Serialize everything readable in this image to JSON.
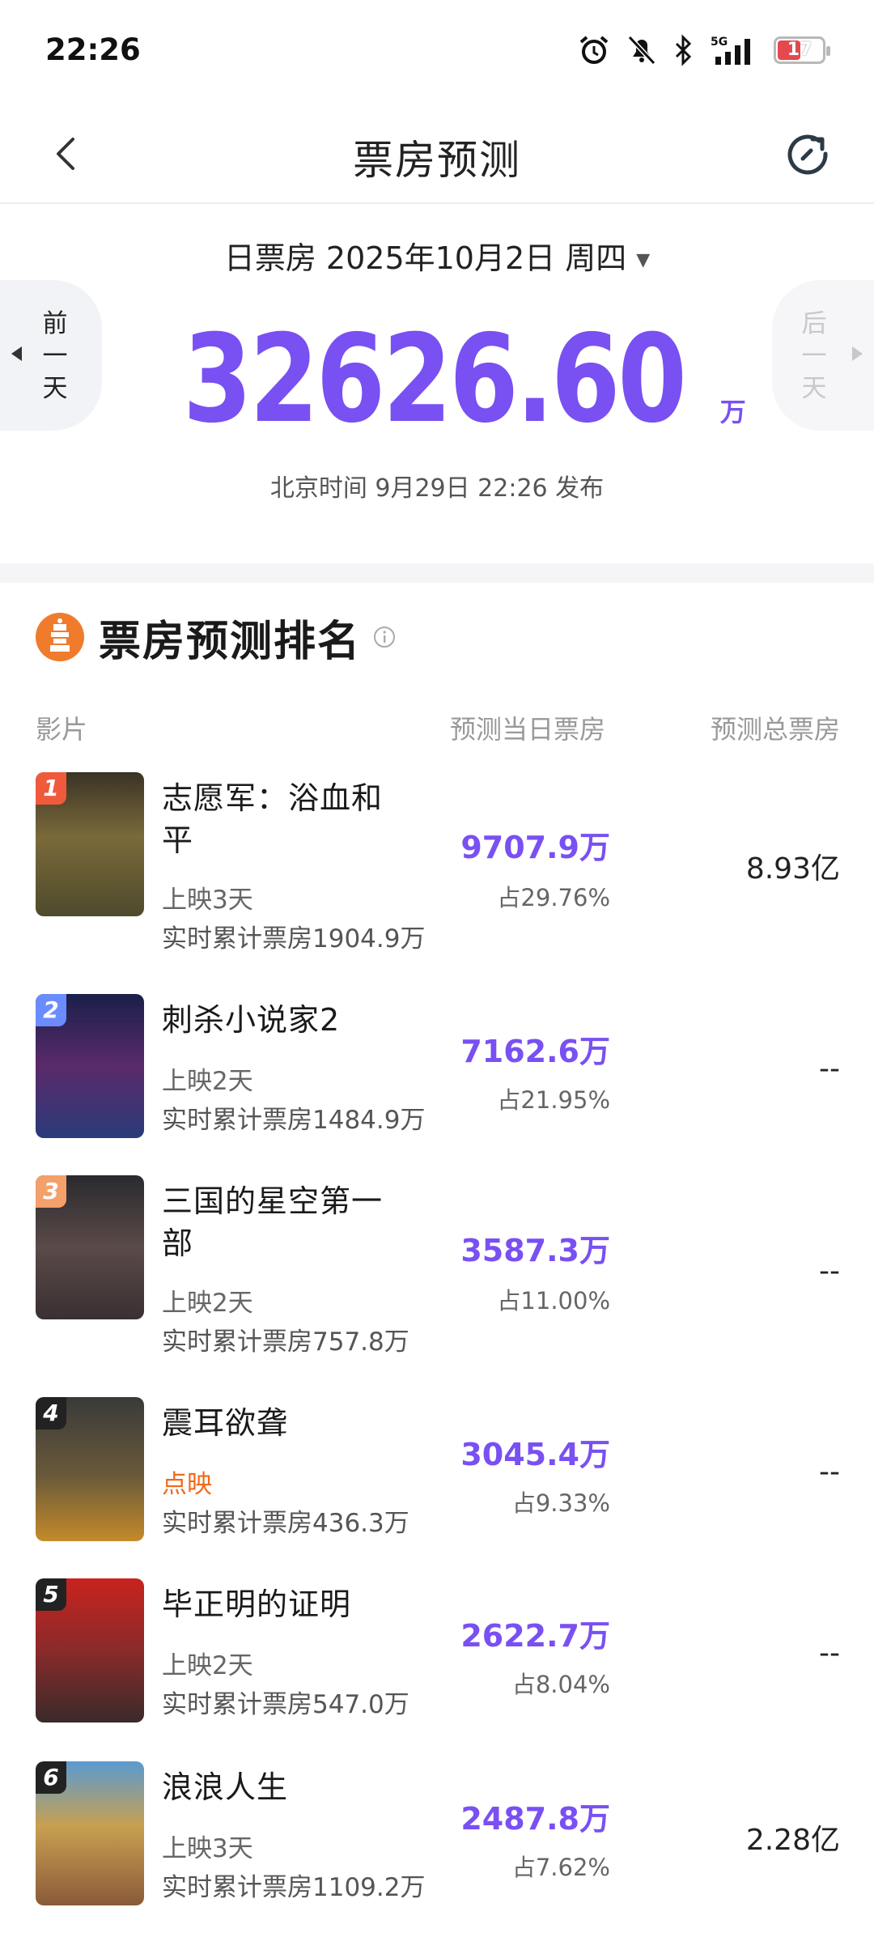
{
  "status_bar": {
    "time": "22:26",
    "battery": "17"
  },
  "nav": {
    "title": "票房预测"
  },
  "summary": {
    "date_label": "日票房 2025年10月2日 周四",
    "prev_label": "前一天",
    "next_label": "后一天",
    "value": "32626.60",
    "unit": "万",
    "publish_time": "北京时间 9月29日 22:26 发布"
  },
  "ranking": {
    "title": "票房预测排名",
    "col_film": "影片",
    "col_day": "预测当日票房",
    "col_total": "预测总票房",
    "movies": [
      {
        "rank": "1",
        "name": "志愿军：浴血和平",
        "status": "上映3天",
        "cumulative": "实时累计票房1904.9万",
        "day_box": "9707.9万",
        "share": "占29.76%",
        "total": "8.93亿"
      },
      {
        "rank": "2",
        "name": "刺杀小说家2",
        "status": "上映2天",
        "cumulative": "实时累计票房1484.9万",
        "day_box": "7162.6万",
        "share": "占21.95%",
        "total": "--"
      },
      {
        "rank": "3",
        "name": "三国的星空第一部",
        "status": "上映2天",
        "cumulative": "实时累计票房757.8万",
        "day_box": "3587.3万",
        "share": "占11.00%",
        "total": "--"
      },
      {
        "rank": "4",
        "name": "震耳欲聋",
        "status": "点映",
        "cumulative": "实时累计票房436.3万",
        "day_box": "3045.4万",
        "share": "占9.33%",
        "total": "--"
      },
      {
        "rank": "5",
        "name": "毕正明的证明",
        "status": "上映2天",
        "cumulative": "实时累计票房547.0万",
        "day_box": "2622.7万",
        "share": "占8.04%",
        "total": "--"
      },
      {
        "rank": "6",
        "name": "浪浪人生",
        "status": "上映3天",
        "cumulative": "实时累计票房1109.2万",
        "day_box": "2487.8万",
        "share": "占7.62%",
        "total": "2.28亿"
      }
    ]
  },
  "colors": {
    "accent": "#7950f2",
    "preview": "#f06a1a",
    "logo": "#f07b2d",
    "rank1": "#f05a3c",
    "rank2": "#6b8cff",
    "rank3": "#f3a06a",
    "rank_other": "#222222"
  },
  "icons": [
    "alarm-icon",
    "mute-icon",
    "bluetooth-icon",
    "signal-5g-icon",
    "battery-icon",
    "back-icon",
    "refresh-icon",
    "info-icon"
  ]
}
